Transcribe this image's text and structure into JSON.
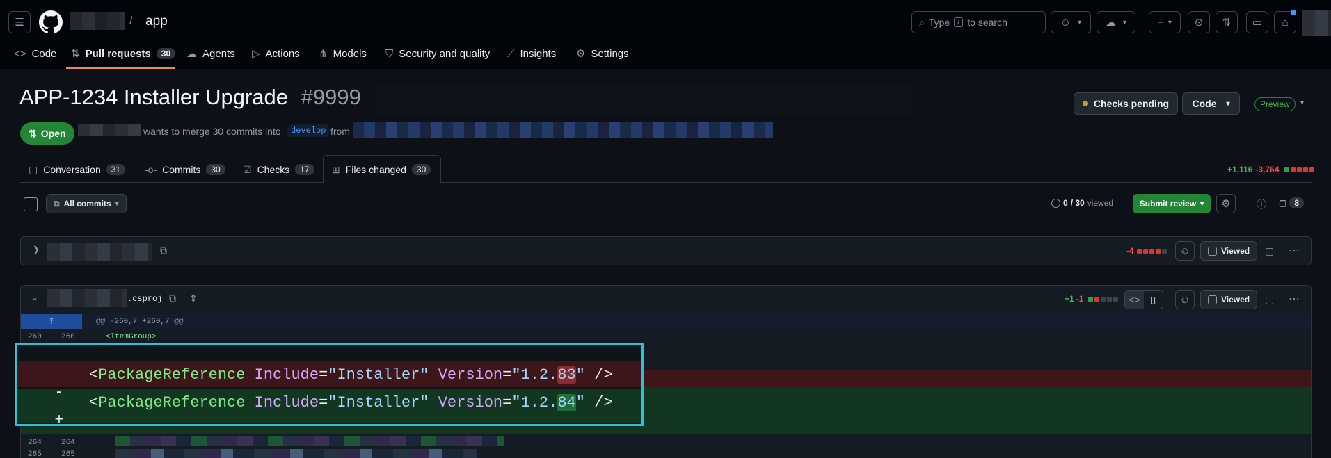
{
  "header": {
    "repo_name": "app",
    "search_placeholder_prefix": "Type",
    "search_key": "/",
    "search_placeholder_suffix": "to search"
  },
  "nav": [
    {
      "label": "Code",
      "icon": "code-icon"
    },
    {
      "label": "Pull requests",
      "count": "30",
      "icon": "pull-request-icon"
    },
    {
      "label": "Agents",
      "icon": "agents-icon"
    },
    {
      "label": "Actions",
      "icon": "play-icon"
    },
    {
      "label": "Models",
      "icon": "models-icon"
    },
    {
      "label": "Security and quality",
      "icon": "shield-icon"
    },
    {
      "label": "Insights",
      "icon": "graph-icon"
    },
    {
      "label": "Settings",
      "icon": "gear-icon"
    }
  ],
  "pr": {
    "title": "APP-1234 Installer Upgrade",
    "number": "#9999",
    "state": "Open",
    "merge_text": "wants to merge 30 commits into",
    "base_branch": "develop",
    "from_text": "from",
    "checks_label": "Checks pending",
    "code_label": "Code",
    "preview_label": "Preview"
  },
  "tabs": [
    {
      "label": "Conversation",
      "count": "31",
      "icon": "comment-icon"
    },
    {
      "label": "Commits",
      "count": "30",
      "icon": "commit-icon"
    },
    {
      "label": "Checks",
      "count": "17",
      "icon": "checklist-icon"
    },
    {
      "label": "Files changed",
      "count": "30",
      "icon": "file-diff-icon"
    }
  ],
  "diff_summary": {
    "additions": "+1,116",
    "deletions": "-3,764"
  },
  "toolbar": {
    "all_commits": "All commits",
    "viewed_count": "0",
    "viewed_total": "/ 30",
    "viewed_label": "viewed",
    "submit_review": "Submit review",
    "comments_count": "8"
  },
  "files": [
    {
      "deletions": "-4",
      "viewed_label": "Viewed"
    },
    {
      "name_suffix": ".csproj",
      "additions": "+1",
      "deletions": "-1",
      "viewed_label": "Viewed"
    }
  ],
  "diff": {
    "hunk_header": "@@ -260,7 +260,7 @@",
    "context_line": {
      "old": "260",
      "new": "260",
      "code": "<ItemGroup>"
    },
    "removed": {
      "sign": "-",
      "tag": "PackageReference",
      "attr1": "Include",
      "val1": "\"Installer\"",
      "attr2": "Version",
      "val2_prefix": "\"1.2.",
      "val2_hl": "83",
      "val2_suffix": "\"",
      "close": "/>"
    },
    "added": {
      "sign": "+",
      "tag": "PackageReference",
      "attr1": "Include",
      "val1": "\"Installer\"",
      "attr2": "Version",
      "val2_prefix": "\"1.2.",
      "val2_hl": "84",
      "val2_suffix": "\"",
      "close": "/>"
    },
    "trailing_lines": [
      {
        "old": "264",
        "new": "264"
      },
      {
        "old": "265",
        "new": "265"
      }
    ]
  },
  "colors": {
    "accent_open": "#238636",
    "highlight_border": "#2fbfd6",
    "deleted_bg": "#3c1618",
    "added_bg": "#12361f"
  }
}
